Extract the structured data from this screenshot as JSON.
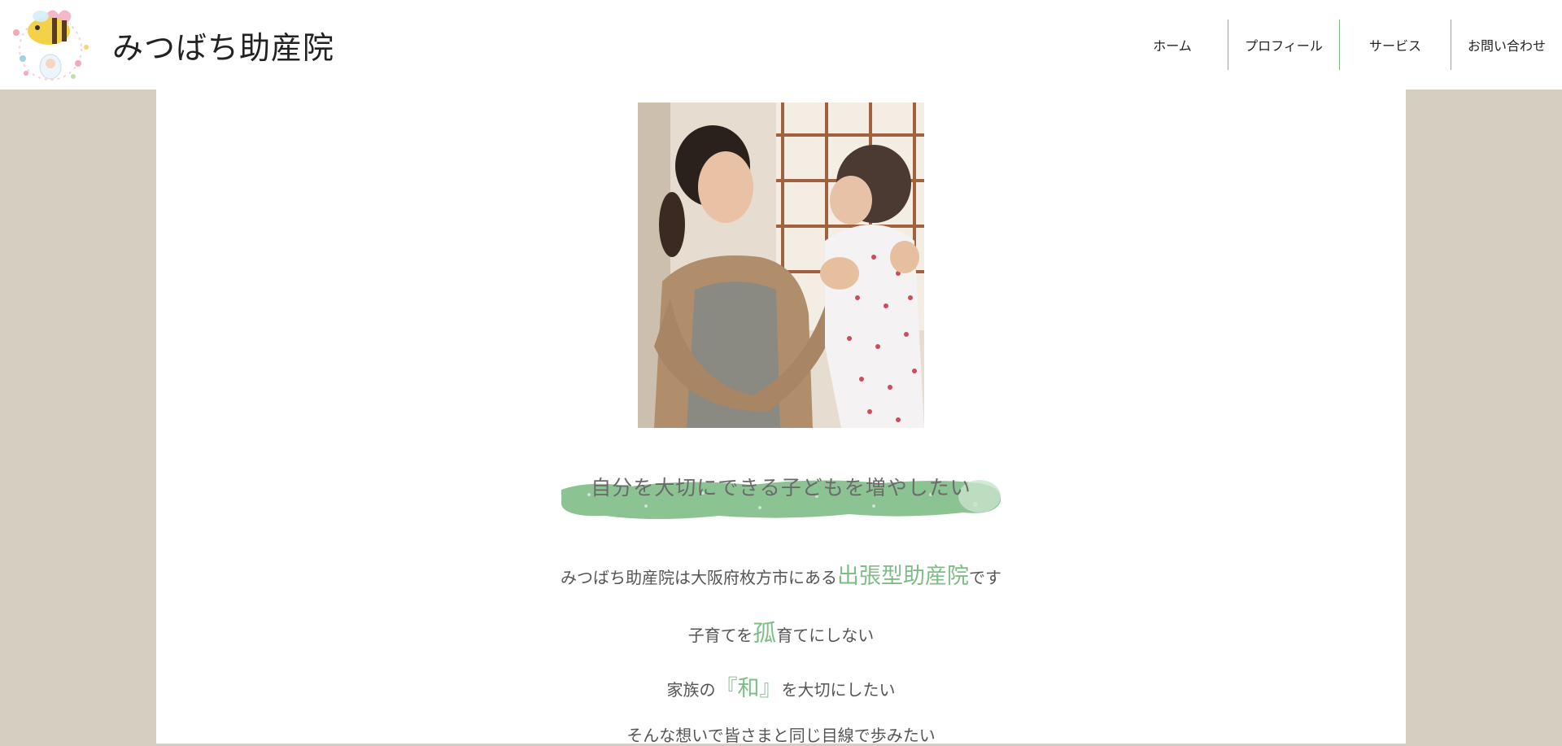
{
  "header": {
    "site_title": "みつばち助産院",
    "logo_icon": "bee-logo-icon"
  },
  "nav": {
    "items": [
      {
        "label": "ホーム"
      },
      {
        "label": "プロフィール"
      },
      {
        "label": "サービス"
      },
      {
        "label": "お問い合わせ"
      }
    ]
  },
  "hero": {
    "photo_alt": "mother-holding-baby-photo",
    "tagline": "自分を大切にできる子どもを増やしたい"
  },
  "intro": {
    "line1_pre": "みつばち助産院は大阪府枚方市にある",
    "line1_hl": "出張型助産院",
    "line1_post": "です",
    "line2_pre": "子育てを",
    "line2_hl": "孤",
    "line2_post": "育てにしない",
    "line3_pre": "家族の",
    "line3_hl": "『和』",
    "line3_post": "を大切にしたい",
    "line4": "そんな想いで皆さまと同じ目線で歩みたい"
  },
  "colors": {
    "accent_green": "#7fbd87",
    "side_background": "#d5cfc1",
    "nav_divider": "#7fb784"
  }
}
